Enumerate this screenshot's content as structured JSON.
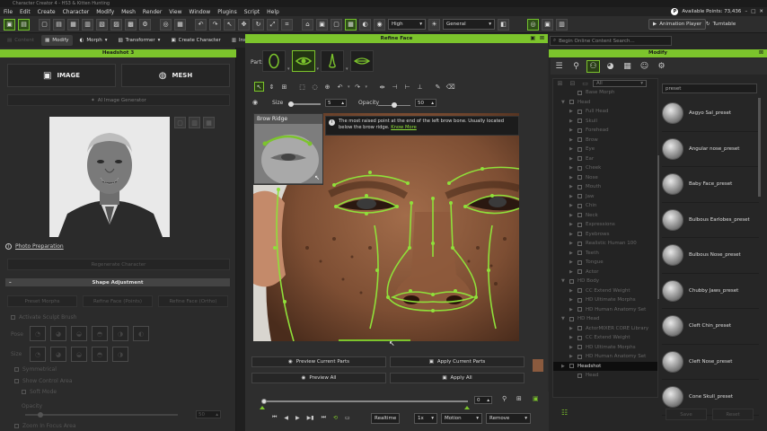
{
  "window": {
    "title": "Character Creator 4 - HS3 & Kitten Hunting"
  },
  "menu": [
    "File",
    "Edit",
    "Create",
    "Character",
    "Modify",
    "Mesh",
    "Render",
    "View",
    "Window",
    "Plugins",
    "Script",
    "Help"
  ],
  "points": {
    "label": "Available Points: 73,436",
    "badge": "P"
  },
  "toolbar": {
    "quality": "High",
    "lighting": "General",
    "animation_player": "Animation Player",
    "turntable": "Turntable"
  },
  "toolbar2": {
    "content": "Content",
    "modify": "Modify",
    "morph": "Morph",
    "transformer": "Transformer",
    "create_character": "Create Character",
    "inspector": "Insi",
    "search_placeholder": "Begin Online Content Search..."
  },
  "left": {
    "title": "Headshot 3",
    "image_tab": "IMAGE",
    "mesh_tab": "MESH",
    "ai_gen": "AI Image Generator",
    "photo_prep": "Photo Preparation",
    "regenerate": "Regenerate Character",
    "shape_adjust": "Shape Adjustment",
    "preset_morphs": "Preset Morphs",
    "refine_face_points": "Refine Face (Points)",
    "refine_face_ortho": "Refine Face (Ortho)",
    "sculpt": "Activate Sculpt Brush",
    "sculpt_rows": [
      "Pose",
      "Size"
    ],
    "symmetrical": "Symmetrical",
    "show_control_area": "Show Control Area",
    "soft_mode": "Soft Mode",
    "opacity": "Opacity",
    "opacity_val": "50",
    "focus": "Zoom In Focus Area"
  },
  "refine": {
    "title": "Refine Face",
    "part_label": "Part:",
    "size_label": "Size",
    "size_val": "5",
    "opacity_label": "Opacity",
    "opacity_val": "50",
    "inset_title": "Brow Ridge",
    "tip_text": "The most raised point at the end of the left brow bone. Usually located below the brow ridge.",
    "tip_link": "Know More",
    "preview_current": "Preview Current Parts",
    "apply_current": "Apply Current Parts",
    "preview_all": "Preview All",
    "apply_all": "Apply All"
  },
  "timeline": {
    "frame": "0",
    "realtime": "Realtime",
    "speed": "1x",
    "motion": "Motion",
    "remove": "Remove"
  },
  "modify": {
    "title": "Modify",
    "filter": "All",
    "search": "preset",
    "tree": [
      {
        "label": "Base Morph",
        "indent": 2,
        "arrow": ""
      },
      {
        "label": "Head",
        "indent": 1,
        "arrow": "▼"
      },
      {
        "label": "Full Head",
        "indent": 2,
        "arrow": "▶"
      },
      {
        "label": "Skull",
        "indent": 2,
        "arrow": "▶"
      },
      {
        "label": "Forehead",
        "indent": 2,
        "arrow": "▶"
      },
      {
        "label": "Brow",
        "indent": 2,
        "arrow": "▶"
      },
      {
        "label": "Eye",
        "indent": 2,
        "arrow": "▶"
      },
      {
        "label": "Ear",
        "indent": 2,
        "arrow": "▶"
      },
      {
        "label": "Cheek",
        "indent": 2,
        "arrow": "▶"
      },
      {
        "label": "Nose",
        "indent": 2,
        "arrow": "▶"
      },
      {
        "label": "Mouth",
        "indent": 2,
        "arrow": "▶"
      },
      {
        "label": "Jaw",
        "indent": 2,
        "arrow": "▶"
      },
      {
        "label": "Chin",
        "indent": 2,
        "arrow": "▶"
      },
      {
        "label": "Neck",
        "indent": 2,
        "arrow": "▶"
      },
      {
        "label": "Expressions",
        "indent": 2,
        "arrow": "▶"
      },
      {
        "label": "Eyebrows",
        "indent": 2,
        "arrow": "▶"
      },
      {
        "label": "Realistic Human 100",
        "indent": 2,
        "arrow": "▶"
      },
      {
        "label": "Teeth",
        "indent": 2,
        "arrow": "▶"
      },
      {
        "label": "Tongue",
        "indent": 2,
        "arrow": "▶"
      },
      {
        "label": "Actor",
        "indent": 2,
        "arrow": "▶"
      },
      {
        "label": "HD Body",
        "indent": 1,
        "arrow": "▼"
      },
      {
        "label": "CC Extend Weight",
        "indent": 2,
        "arrow": "▶"
      },
      {
        "label": "HD Ultimate Morphs",
        "indent": 2,
        "arrow": "▶"
      },
      {
        "label": "HD Human Anatomy Set",
        "indent": 2,
        "arrow": "▶"
      },
      {
        "label": "HD Head",
        "indent": 1,
        "arrow": "▼"
      },
      {
        "label": "ActorMIXER CORE Library",
        "indent": 2,
        "arrow": "▶"
      },
      {
        "label": "CC Extend Weight",
        "indent": 2,
        "arrow": "▶"
      },
      {
        "label": "HD Ultimate Morphs",
        "indent": 2,
        "arrow": "▶"
      },
      {
        "label": "HD Human Anatomy Set",
        "indent": 2,
        "arrow": "▶"
      },
      {
        "label": "Headshot",
        "indent": 1,
        "arrow": "▶",
        "active": true
      },
      {
        "label": "Head",
        "indent": 2,
        "arrow": ""
      }
    ],
    "presets": [
      "Asgyo Sal_preset",
      "Angular nose_preset",
      "Baby Face_preset",
      "Bulbous Earlobes_preset",
      "Bulbous Nose_preset",
      "Chubby Jaws_preset",
      "Cleft Chin_preset",
      "Cleft Nose_preset",
      "Cone Skull_preset"
    ],
    "save": "Save",
    "reset": "Reset"
  }
}
